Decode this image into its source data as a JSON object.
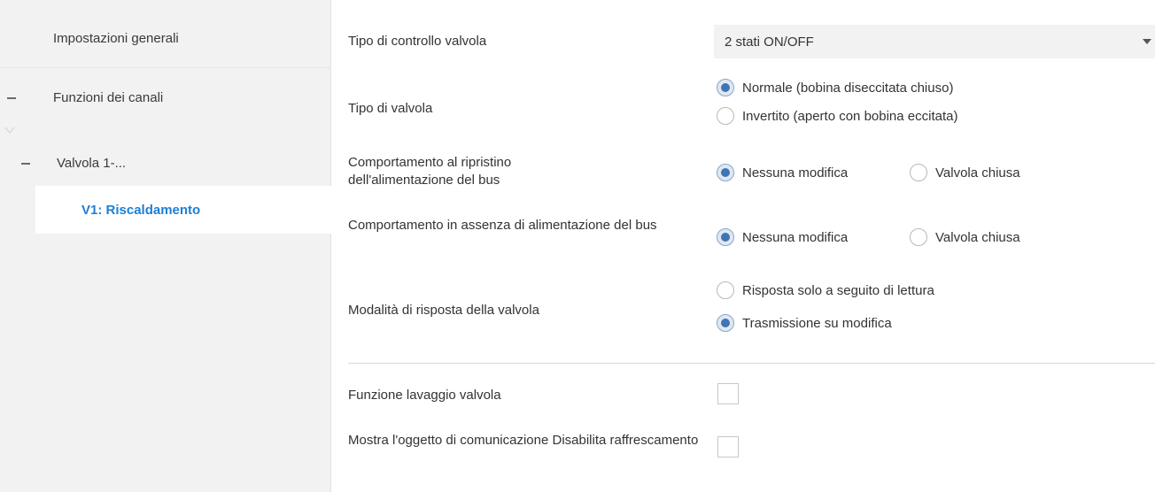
{
  "sidebar": {
    "general": "Impostazioni generali",
    "functions": "Funzioni dei canali",
    "valve": "Valvola 1-...",
    "heating": "V1: Riscaldamento"
  },
  "settings": {
    "control_type": {
      "label": "Tipo di controllo valvola",
      "value": "2 stati ON/OFF"
    },
    "valve_type": {
      "label": "Tipo di valvola",
      "options": [
        "Normale (bobina diseccitata chiuso)",
        "Invertito (aperto con bobina eccitata)"
      ],
      "selected": 0
    },
    "bus_restore": {
      "label": "Comportamento al ripristino dell'alimentazione del bus",
      "options": [
        "Nessuna modifica",
        "Valvola chiusa"
      ],
      "selected": 0
    },
    "bus_loss": {
      "label": "Comportamento in assenza di alimentazione del bus",
      "options": [
        "Nessuna modifica",
        "Valvola chiusa"
      ],
      "selected": 0
    },
    "response_mode": {
      "label": "Modalità di risposta della valvola",
      "options": [
        "Risposta solo a seguito di lettura",
        "Trasmissione su modifica"
      ],
      "selected": 1
    },
    "wash_function": {
      "label": "Funzione lavaggio valvola",
      "checked": false
    },
    "show_disable_cooling": {
      "label": "Mostra l'oggetto di comunicazione Disabilita raffrescamento",
      "checked": false
    }
  },
  "colors": {
    "accent": "#1c7fd6",
    "radio_selected": "#3f74b5",
    "sidebar_bg": "#f2f2f2"
  }
}
